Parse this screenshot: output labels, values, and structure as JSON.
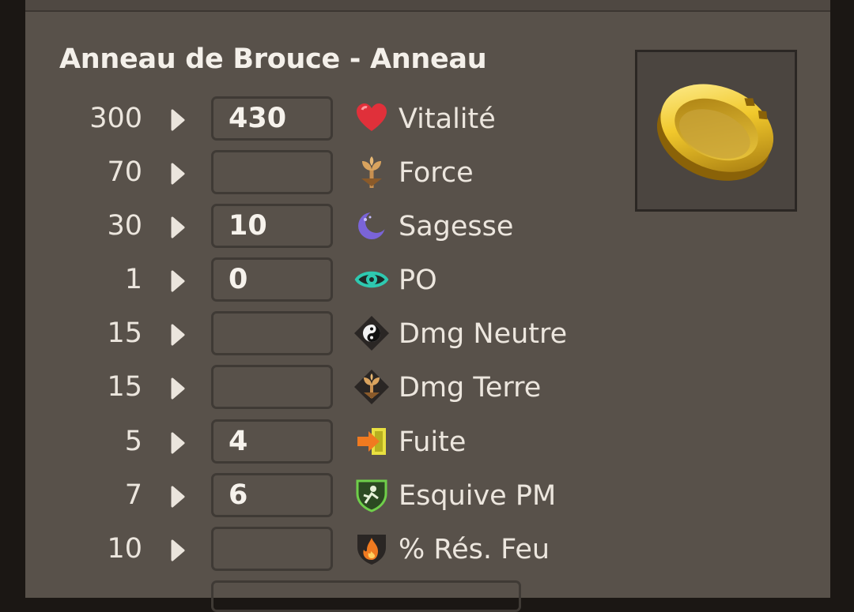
{
  "item": {
    "title": "Anneau de Brouce - Anneau",
    "image_icon": "gold-ring-icon"
  },
  "stats": [
    {
      "base": "300",
      "value": "430",
      "label": "Vitalité",
      "icon": "heart-icon"
    },
    {
      "base": "70",
      "value": "",
      "label": "Force",
      "icon": "earth-sprout-icon"
    },
    {
      "base": "30",
      "value": "10",
      "label": "Sagesse",
      "icon": "moon-icon"
    },
    {
      "base": "1",
      "value": "0",
      "label": "PO",
      "icon": "eye-icon"
    },
    {
      "base": "15",
      "value": "",
      "label": "Dmg Neutre",
      "icon": "yin-yang-icon"
    },
    {
      "base": "15",
      "value": "",
      "label": "Dmg Terre",
      "icon": "earth-diamond-icon"
    },
    {
      "base": "5",
      "value": "4",
      "label": "Fuite",
      "icon": "exit-arrow-icon"
    },
    {
      "base": "7",
      "value": "6",
      "label": "Esquive PM",
      "icon": "dodge-shield-icon"
    },
    {
      "base": "10",
      "value": "",
      "label": "% Rés. Feu",
      "icon": "fire-shield-icon"
    }
  ],
  "colors": {
    "panel": "#58514a",
    "text": "#ece6de",
    "field_border": "#3f3a35"
  }
}
